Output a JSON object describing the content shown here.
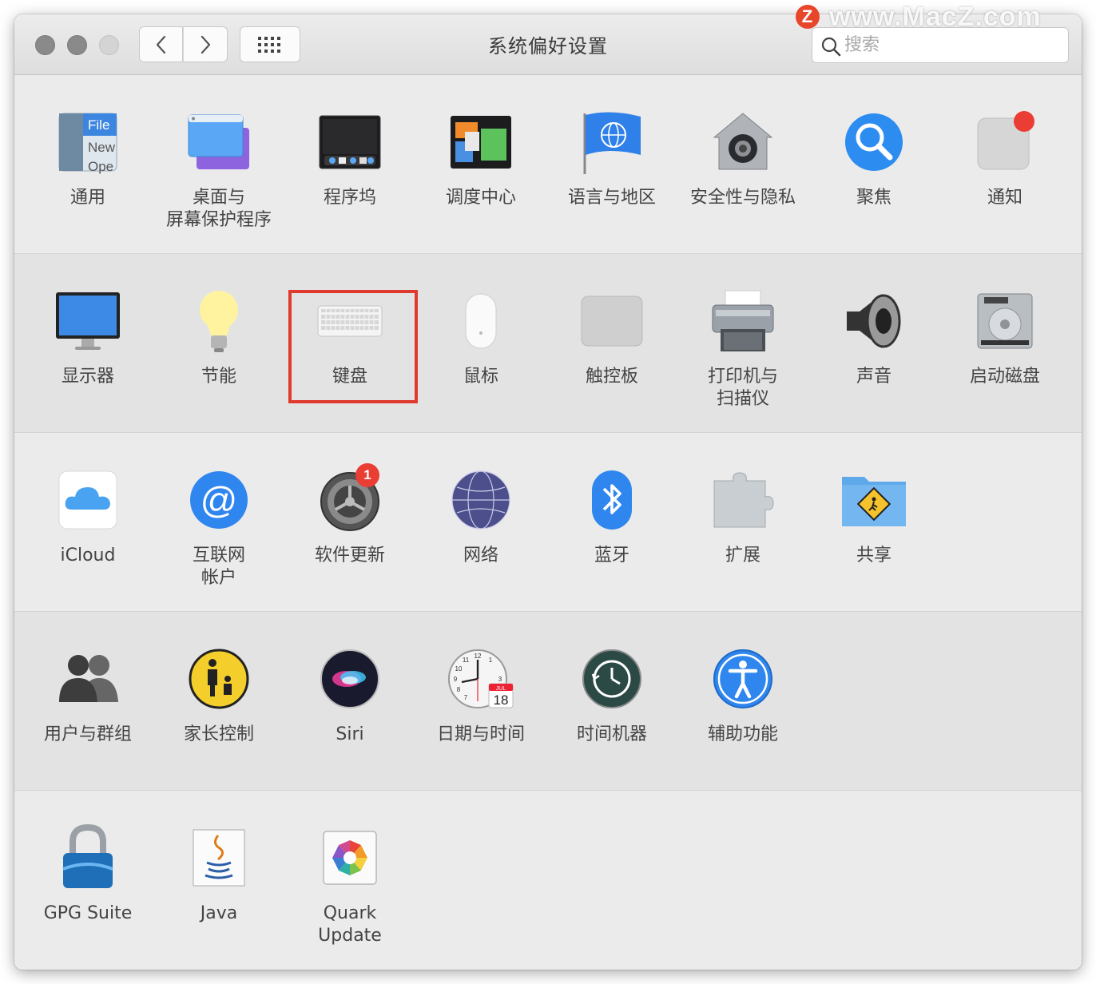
{
  "window": {
    "title": "系统偏好设置",
    "search": {
      "placeholder": "搜索",
      "value": ""
    }
  },
  "watermark": {
    "text": "www.MacZ.com",
    "logo": "Z"
  },
  "sections": [
    {
      "items": [
        {
          "label": "通用",
          "icon": "general-icon"
        },
        {
          "label": "桌面与\n屏幕保护程序",
          "icon": "desktop-screensaver-icon"
        },
        {
          "label": "程序坞",
          "icon": "dock-icon"
        },
        {
          "label": "调度中心",
          "icon": "mission-control-icon"
        },
        {
          "label": "语言与地区",
          "icon": "language-region-icon"
        },
        {
          "label": "安全性与隐私",
          "icon": "security-privacy-icon"
        },
        {
          "label": "聚焦",
          "icon": "spotlight-icon"
        },
        {
          "label": "通知",
          "icon": "notifications-icon"
        }
      ]
    },
    {
      "items": [
        {
          "label": "显示器",
          "icon": "displays-icon"
        },
        {
          "label": "节能",
          "icon": "energy-saver-icon"
        },
        {
          "label": "键盘",
          "icon": "keyboard-icon"
        },
        {
          "label": "鼠标",
          "icon": "mouse-icon"
        },
        {
          "label": "触控板",
          "icon": "trackpad-icon"
        },
        {
          "label": "打印机与\n扫描仪",
          "icon": "printers-scanners-icon"
        },
        {
          "label": "声音",
          "icon": "sound-icon"
        },
        {
          "label": "启动磁盘",
          "icon": "startup-disk-icon"
        }
      ]
    },
    {
      "items": [
        {
          "label": "iCloud",
          "icon": "icloud-icon"
        },
        {
          "label": "互联网\n帐户",
          "icon": "internet-accounts-icon"
        },
        {
          "label": "软件更新",
          "icon": "software-update-icon",
          "badge": "1"
        },
        {
          "label": "网络",
          "icon": "network-icon"
        },
        {
          "label": "蓝牙",
          "icon": "bluetooth-icon"
        },
        {
          "label": "扩展",
          "icon": "extensions-icon"
        },
        {
          "label": "共享",
          "icon": "sharing-icon"
        }
      ]
    },
    {
      "items": [
        {
          "label": "用户与群组",
          "icon": "users-groups-icon"
        },
        {
          "label": "家长控制",
          "icon": "parental-controls-icon"
        },
        {
          "label": "Siri",
          "icon": "siri-icon"
        },
        {
          "label": "日期与时间",
          "icon": "date-time-icon"
        },
        {
          "label": "时间机器",
          "icon": "time-machine-icon"
        },
        {
          "label": "辅助功能",
          "icon": "accessibility-icon"
        }
      ]
    },
    {
      "items": [
        {
          "label": "GPG Suite",
          "icon": "gpg-suite-icon"
        },
        {
          "label": "Java",
          "icon": "java-icon"
        },
        {
          "label": "Quark\nUpdate",
          "icon": "quark-update-icon"
        }
      ]
    }
  ],
  "icon_text": {
    "general": {
      "file": "File",
      "new": "New",
      "open": "Ope"
    },
    "clock_numbers": [
      "12",
      "1",
      "3",
      "8",
      "9",
      "10",
      "11",
      "7"
    ],
    "calendar": {
      "month": "JUL",
      "day": "18"
    }
  },
  "highlight": {
    "target": "键盘",
    "color": "#e03a2e"
  },
  "colors": {
    "accent_blue": "#2f7ef5",
    "badge_red": "#ea3d34"
  }
}
